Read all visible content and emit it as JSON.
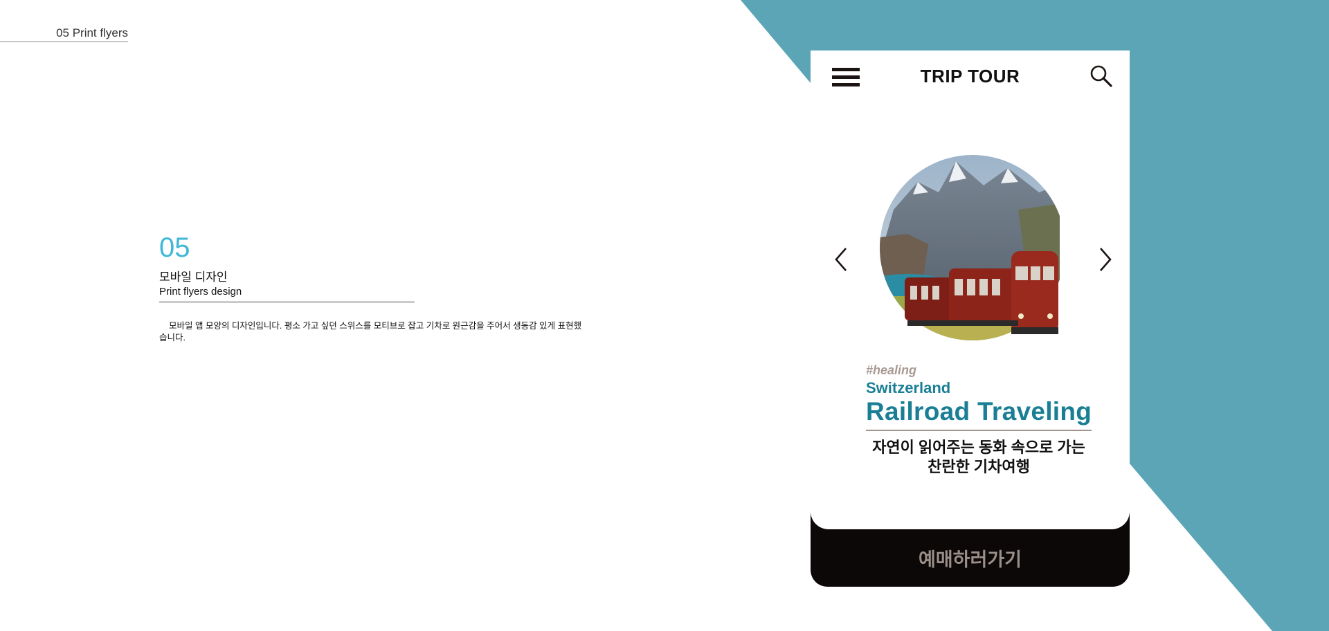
{
  "section_tag": "05 Print flyers",
  "intro": {
    "number": "05",
    "title_kr": "모바일 디자인",
    "title_en": "Print flyers design",
    "description": "모바일 앱 모양의 디자인입니다. 평소 가고 싶던 스위스를 모티브로 잡고 기차로 원근감을 주어서 생동감 있게 표현했습니다."
  },
  "phone": {
    "brand": "TRIP TOUR",
    "hashtag": "#healing",
    "place": "Switzerland",
    "headline": "Railroad Traveling",
    "subcopy_line1": "자연이 읽어주는 동화 속으로 가는",
    "subcopy_line2": "찬란한 기차여행",
    "cta_label": "예매하러가기"
  },
  "icons": {
    "menu": "hamburger-menu-icon",
    "search": "search-icon",
    "prev": "chevron-left-icon",
    "next": "chevron-right-icon"
  },
  "colors": {
    "accent_teal": "#5ba5b6",
    "number_blue": "#3fb6d8",
    "headline_teal": "#1a7f95",
    "hashtag_gray": "#a89a93",
    "cta_bg": "#0c0807",
    "cta_text": "#9a8f89"
  }
}
